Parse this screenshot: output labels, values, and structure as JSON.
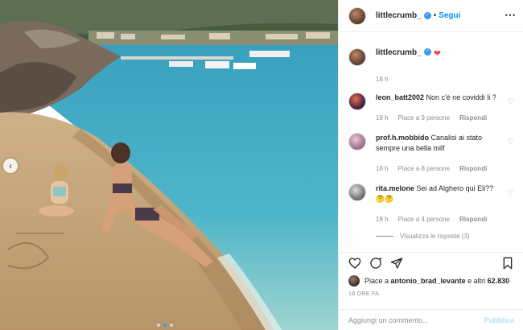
{
  "post": {
    "username": "littlecrumb_",
    "follow_label": "Segui",
    "separator": "•",
    "more_icon": "⋯",
    "caption_emoji": "❤",
    "caption_time": "18 h"
  },
  "comments": [
    {
      "user": "leon_batt2002",
      "text": "Non c'è ne coviddi li ?",
      "time": "18 h",
      "likes": "Piace a 9 persone",
      "reply": "Rispondi"
    },
    {
      "user": "prof.h.mobbido",
      "text": "Canalisi ai stato sempre una bella milf",
      "time": "18 h",
      "likes": "Piace a 8 persone",
      "reply": "Rispondi"
    },
    {
      "user": "rita.melone",
      "text": "Sei ad Alghero qui Eli?? 🤔🤔",
      "time": "18 h",
      "likes": "Piace a 4 persone",
      "reply": "Rispondi"
    }
  ],
  "replies_label": "Visualizza le risposte (3)",
  "likes": {
    "prefix": "Piace a ",
    "user": "antonio_brad_levante",
    "suffix": " e altri ",
    "count": "62.830"
  },
  "post_time": "18 ORE FA",
  "add_comment": {
    "placeholder": "Aggiungi un commento...",
    "publish": "Pubblica"
  },
  "colors": {
    "accent": "#0095f6",
    "verified": "#3897f0",
    "heart": "#ed4956"
  }
}
